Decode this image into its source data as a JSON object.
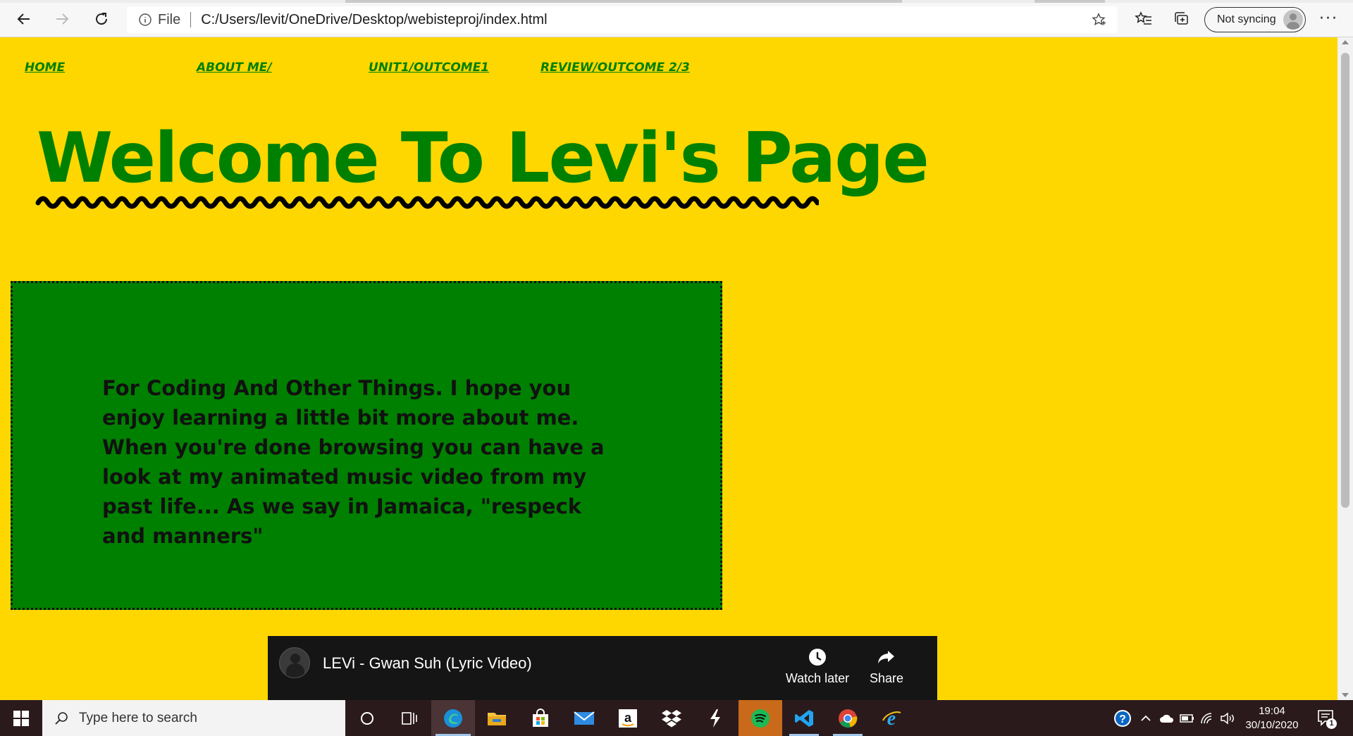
{
  "browser": {
    "address_prefix": "File",
    "address_url": "C:/Users/levit/OneDrive/Desktop/webisteproj/index.html",
    "sync_label": "Not syncing",
    "more_label": "···"
  },
  "page": {
    "nav": [
      "HOME",
      "ABOUT ME/",
      "UNIT1/OUTCOME1",
      "REVIEW/OUTCOME 2/3"
    ],
    "headline": "Welcome To Levi's Page",
    "intro": "For Coding And Other Things. I hope you enjoy learning a little bit more about me. When you're done browsing you can have a look at my animated music video from my past life... As we say in Jamaica, \"respeck and manners\"",
    "video": {
      "title": "LEVi - Gwan Suh (Lyric Video)",
      "watch_later": "Watch later",
      "share": "Share"
    }
  },
  "taskbar": {
    "search_placeholder": "Type here to search",
    "time": "19:04",
    "date": "30/10/2020",
    "notification_count": "1",
    "apps": [
      "cortana",
      "task-view",
      "edge",
      "file-explorer",
      "store",
      "mail",
      "amazon",
      "dropbox",
      "app",
      "spotify",
      "vscode",
      "chrome",
      "internet-explorer"
    ]
  },
  "colors": {
    "page_bg": "#ffd700",
    "accent_green": "#008000",
    "taskbar_bg": "#2b1a1c"
  }
}
